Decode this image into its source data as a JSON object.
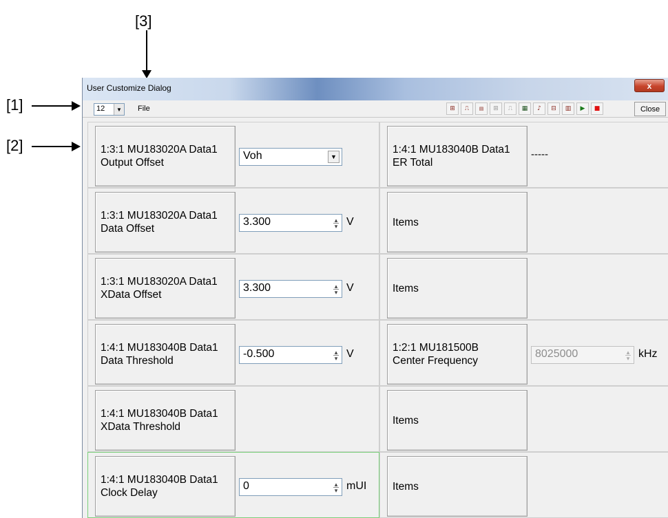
{
  "callouts": [
    "[1]",
    "[2]",
    "[3]"
  ],
  "window": {
    "title": "User Customize Dialog",
    "close_glyph": "x"
  },
  "toolbar": {
    "zoom_value": "12",
    "file_label": "File",
    "close_label": "Close",
    "icons": [
      "pattern-icon",
      "pulse-icon",
      "data-icon",
      "pattern-icon-2",
      "pulse-icon-2",
      "gate-icon",
      "sound-icon",
      "error-icon",
      "bitmap-icon",
      "play-icon",
      "stop-icon"
    ]
  },
  "colors": {
    "window_bg": "#f0f0f0",
    "active_border": "#7ad07a",
    "play": "#1a7a1a",
    "stop": "#e01010"
  },
  "left_cells": [
    {
      "line1": "1:3:1 MU183020A Data1",
      "line2": "Output Offset",
      "control": "select",
      "value": "Voh",
      "unit": ""
    },
    {
      "line1": "1:3:1 MU183020A Data1",
      "line2": "Data Offset",
      "control": "spin",
      "value": "3.300",
      "unit": "V"
    },
    {
      "line1": "1:3:1 MU183020A Data1",
      "line2": "XData Offset",
      "control": "spin",
      "value": "3.300",
      "unit": "V"
    },
    {
      "line1": "1:4:1 MU183040B Data1",
      "line2": "Data Threshold",
      "control": "spin",
      "value": "-0.500",
      "unit": "V"
    },
    {
      "line1": "1:4:1 MU183040B Data1",
      "line2": "XData Threshold",
      "control": "none",
      "value": "",
      "unit": ""
    },
    {
      "line1": "1:4:1 MU183040B Data1",
      "line2": "Clock Delay",
      "control": "spin",
      "value": "0",
      "unit": "mUI"
    }
  ],
  "right_cells": [
    {
      "line1": "1:4:1 MU183040B Data1",
      "line2": "ER Total",
      "control": "readout",
      "value": "-----",
      "unit": ""
    },
    {
      "line1": "Items",
      "line2": "",
      "control": "none",
      "value": "",
      "unit": ""
    },
    {
      "line1": "Items",
      "line2": "",
      "control": "none",
      "value": "",
      "unit": ""
    },
    {
      "line1": "1:2:1 MU181500B",
      "line2": "Center Frequency",
      "control": "spin-disabled",
      "value": "8025000",
      "unit": "kHz"
    },
    {
      "line1": "Items",
      "line2": "",
      "control": "none",
      "value": "",
      "unit": ""
    },
    {
      "line1": "Items",
      "line2": "",
      "control": "none",
      "value": "",
      "unit": ""
    }
  ]
}
